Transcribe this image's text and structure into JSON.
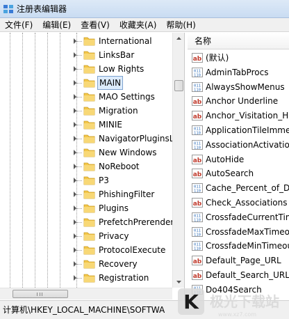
{
  "window": {
    "title": "注册表编辑器"
  },
  "menu": [
    {
      "label": "文件(F)"
    },
    {
      "label": "编辑(E)"
    },
    {
      "label": "查看(V)"
    },
    {
      "label": "收藏夹(A)"
    },
    {
      "label": "帮助(H)"
    }
  ],
  "tree": {
    "items": [
      {
        "label": "International"
      },
      {
        "label": "LinksBar"
      },
      {
        "label": "Low Rights"
      },
      {
        "label": "MAIN",
        "selected": true
      },
      {
        "label": "MAO Settings"
      },
      {
        "label": "Migration"
      },
      {
        "label": "MINIE"
      },
      {
        "label": "NavigatorPluginsL"
      },
      {
        "label": "New Windows"
      },
      {
        "label": "NoReboot"
      },
      {
        "label": "P3"
      },
      {
        "label": "PhishingFilter"
      },
      {
        "label": "Plugins"
      },
      {
        "label": "PrefetchPrerender"
      },
      {
        "label": "Privacy"
      },
      {
        "label": "ProtocolExecute"
      },
      {
        "label": "Recovery"
      },
      {
        "label": "Registration"
      }
    ]
  },
  "values": {
    "column_name": "名称",
    "rows": [
      {
        "name": "(默认)",
        "type": "string"
      },
      {
        "name": "AdminTabProcs",
        "type": "binary"
      },
      {
        "name": "AlwaysShowMenus",
        "type": "binary"
      },
      {
        "name": "Anchor Underline",
        "type": "string"
      },
      {
        "name": "Anchor_Visitation_Ho",
        "type": "string"
      },
      {
        "name": "ApplicationTileImme",
        "type": "binary"
      },
      {
        "name": "AssociationActivation",
        "type": "binary"
      },
      {
        "name": "AutoHide",
        "type": "string"
      },
      {
        "name": "AutoSearch",
        "type": "string"
      },
      {
        "name": "Cache_Percent_of_Dis",
        "type": "binary"
      },
      {
        "name": "Check_Associations",
        "type": "string"
      },
      {
        "name": "CrossfadeCurrentTim",
        "type": "binary"
      },
      {
        "name": "CrossfadeMaxTimeo",
        "type": "binary"
      },
      {
        "name": "CrossfadeMinTimeou",
        "type": "binary"
      },
      {
        "name": "Default_Page_URL",
        "type": "string"
      },
      {
        "name": "Default_Search_URL",
        "type": "string"
      },
      {
        "name": "Do404Search",
        "type": "binary"
      }
    ]
  },
  "statusbar": {
    "path": "计算机\\HKEY_LOCAL_MACHINE\\SOFTWA"
  },
  "watermark": {
    "text": "K 极光下载站",
    "url": "www.xz7.com"
  },
  "colors": {
    "folder": "#f4c74a",
    "string_icon": "#c0392b",
    "binary_icon": "#2f6fba",
    "selection": "#dcebfc"
  }
}
